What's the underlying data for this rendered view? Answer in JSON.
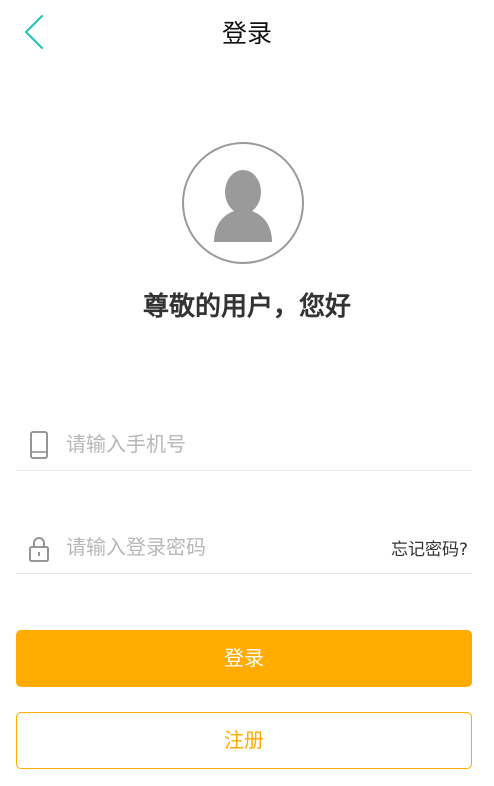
{
  "colors": {
    "accent": "#ffab00",
    "back_arrow": "#2bc4b6",
    "text": "#333333",
    "placeholder": "#b7b7b7"
  },
  "header": {
    "back_icon": "chevron-left-icon",
    "title": "登录"
  },
  "avatar": {
    "icon": "user-silhouette-icon"
  },
  "greeting": "尊敬的用户，您好",
  "phone": {
    "icon": "phone-icon",
    "placeholder": "请输入手机号",
    "value": ""
  },
  "password": {
    "icon": "lock-icon",
    "placeholder": "请输入登录密码",
    "value": "",
    "forgot_label": "忘记密码?"
  },
  "buttons": {
    "login_label": "登录",
    "register_label": "注册"
  }
}
